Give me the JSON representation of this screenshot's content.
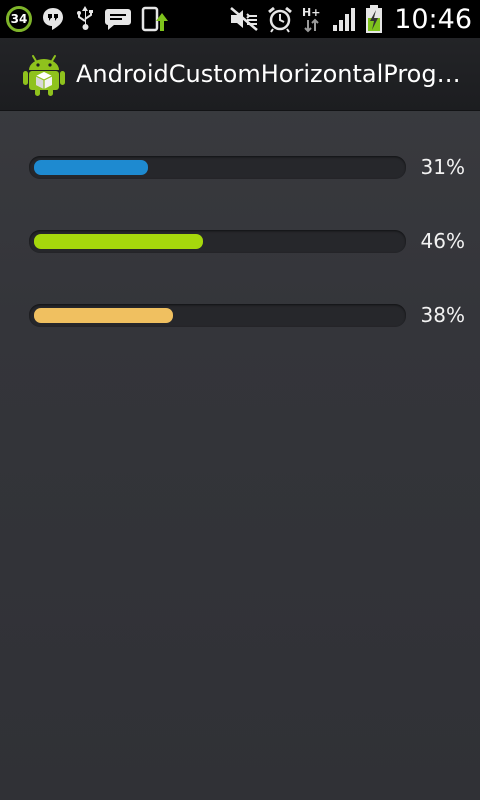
{
  "status_bar": {
    "notification_count": "34",
    "left_icons": [
      "notification-count-icon",
      "hangouts-icon",
      "usb-icon",
      "message-icon",
      "device-update-icon"
    ],
    "right_icons": [
      "mute-icon",
      "alarm-icon",
      "network-h-plus-icon",
      "signal-icon",
      "battery-charging-icon"
    ],
    "network_label": "H+",
    "time": "10:46"
  },
  "action_bar": {
    "app_icon": "android-icon",
    "title": "AndroidCustomHorizontalProgr…"
  },
  "progress_bars": [
    {
      "percent_label": "31%",
      "value": 0.31,
      "color": "#1e8ad0"
    },
    {
      "percent_label": "46%",
      "value": 0.46,
      "color": "#a6d80c"
    },
    {
      "percent_label": "38%",
      "value": 0.38,
      "color": "#f0c060"
    }
  ]
}
